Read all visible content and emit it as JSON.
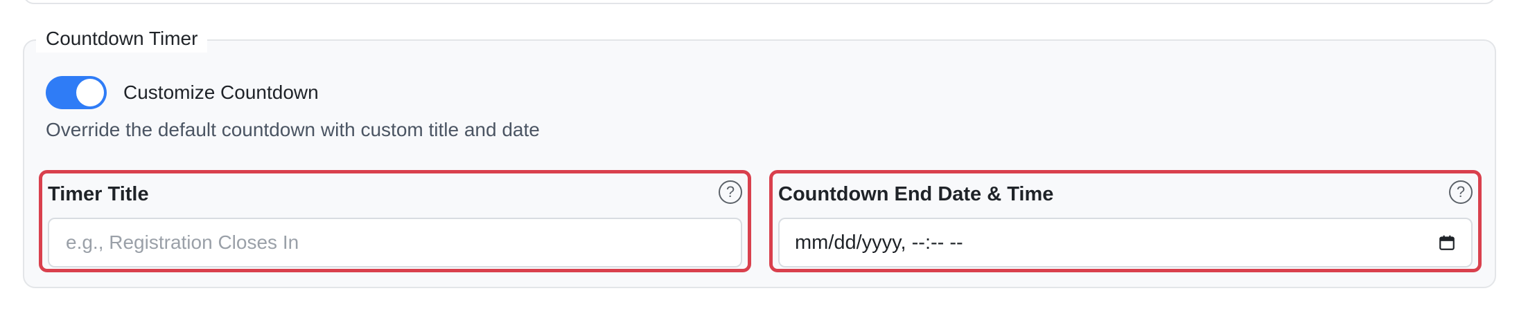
{
  "section": {
    "legend": "Countdown Timer"
  },
  "toggle": {
    "label": "Customize Countdown",
    "checked": true,
    "accent_color": "#2f7cf6"
  },
  "helper_text": "Override the default countdown with custom title and date",
  "fields": {
    "timer_title": {
      "label": "Timer Title",
      "placeholder": "e.g., Registration Closes In",
      "value": "",
      "help_icon": "?"
    },
    "end_datetime": {
      "label": "Countdown End Date & Time",
      "value_display": "mm/dd/yyyy, --:-- --",
      "help_icon": "?"
    }
  },
  "highlight_color": "#d9404d"
}
